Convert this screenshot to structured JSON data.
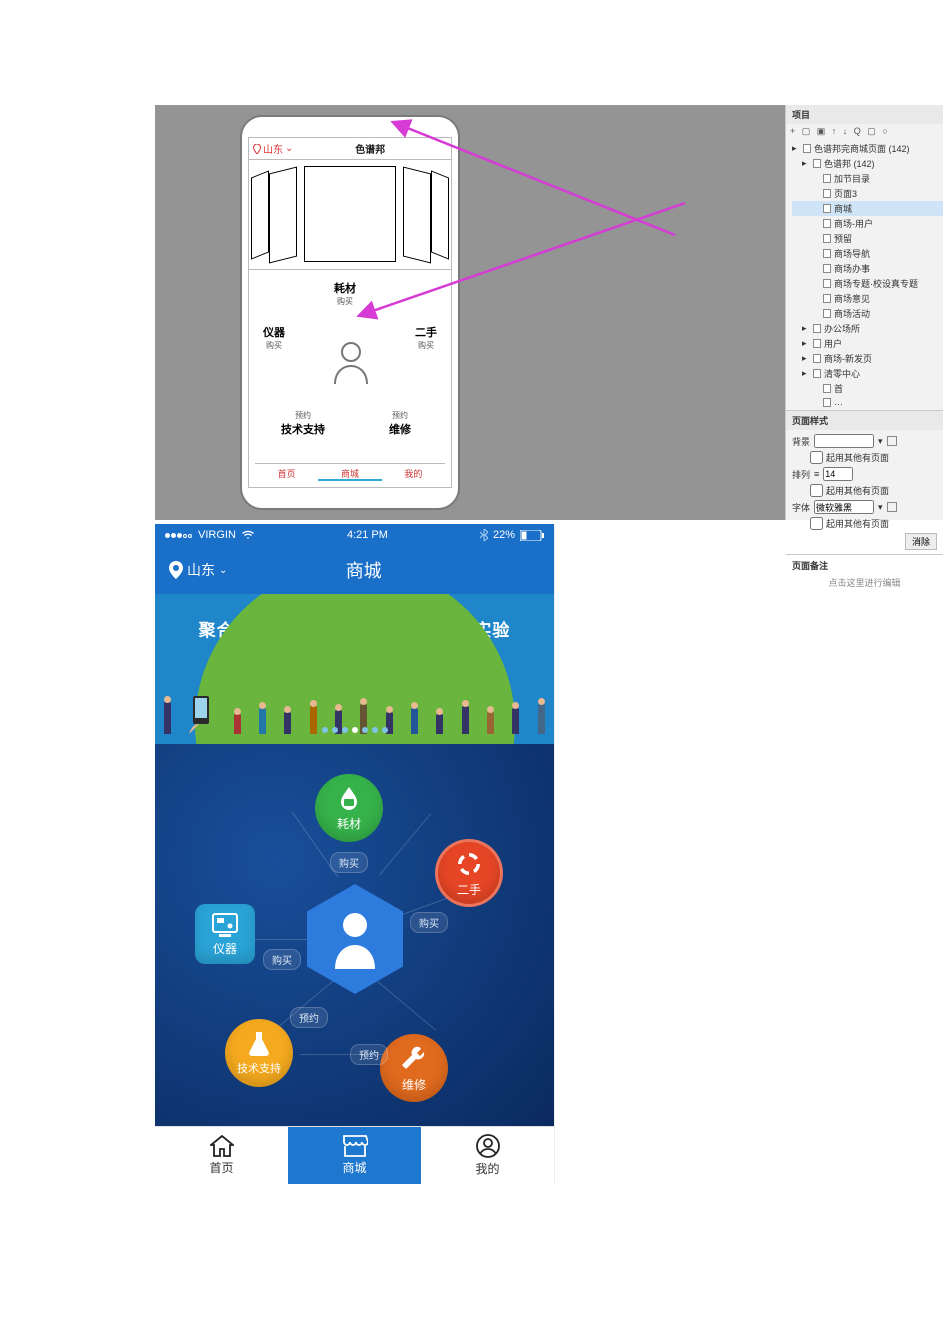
{
  "wireframe": {
    "location_label": "山东",
    "app_title": "色谱邦",
    "categories": {
      "top": {
        "label": "耗材",
        "sub": "购买"
      },
      "left": {
        "label": "仪器",
        "sub": "购买"
      },
      "right": {
        "label": "二手",
        "sub": "购买"
      },
      "bl": {
        "label": "技术支持",
        "sub": "预约"
      },
      "br": {
        "label": "维修",
        "sub": "预约"
      }
    },
    "tabs": [
      "首页",
      "商城",
      "我的"
    ]
  },
  "axure_panel": {
    "project_header": "项目",
    "toolbar_glyphs": "+ ▢ ▣ ↑ ↓ Q ▢ ○",
    "tree": [
      {
        "label": "色谱邦完商城页面 (142)",
        "indent": 0
      },
      {
        "label": "色谱邦 (142)",
        "indent": 1
      },
      {
        "label": "加节目录",
        "indent": 2
      },
      {
        "label": "页面3",
        "indent": 2
      },
      {
        "label": "商城",
        "indent": 2,
        "selected": true
      },
      {
        "label": "商场-用户",
        "indent": 2
      },
      {
        "label": "预留",
        "indent": 2
      },
      {
        "label": "商场导航",
        "indent": 2
      },
      {
        "label": "商场办事",
        "indent": 2
      },
      {
        "label": "商场专题·校设真专题",
        "indent": 2
      },
      {
        "label": "商场意见",
        "indent": 2
      },
      {
        "label": "商场活动",
        "indent": 2
      },
      {
        "label": "办公场所",
        "indent": 1
      },
      {
        "label": "用户",
        "indent": 1
      },
      {
        "label": "商场-新发页",
        "indent": 1
      },
      {
        "label": "清零中心",
        "indent": 1
      },
      {
        "label": "首",
        "indent": 2
      },
      {
        "label": "…",
        "indent": 2
      }
    ],
    "style_header": "页面样式",
    "style": {
      "bg_label": "背景",
      "bg_checkbox": "起用其他有页面",
      "align_label": "排列",
      "align_value": "14",
      "align_checkbox": "起用其他有页面",
      "font_label": "字体",
      "font_value": "微软雅黑",
      "font_checkbox": "起用其他有页面",
      "clear_button": "消除"
    },
    "notes_header": "页面备注",
    "notes_hint": "点击这里进行编辑"
  },
  "mockup": {
    "statusbar": {
      "carrier": "VIRGIN",
      "time": "4:21 PM",
      "battery_text": "22%"
    },
    "topnav": {
      "location": "山东",
      "title": "商城"
    },
    "banner_text": "聚合众人的智慧   让天下没有难做的实验",
    "pager_count": 7,
    "pager_active_index": 3,
    "nodes": {
      "haocai": {
        "label": "耗材",
        "color": "#36b24a"
      },
      "ershou": {
        "label": "二手",
        "color": "#e74626"
      },
      "yiqi": {
        "label": "仪器",
        "color": "#2aa3d6"
      },
      "jishu": {
        "label": "技术支持",
        "color": "#f4a91e"
      },
      "weixiu": {
        "label": "维修",
        "color": "#e06a1e"
      }
    },
    "chips": {
      "buy": "购买",
      "book": "预约"
    },
    "tabs": [
      {
        "label": "首页",
        "icon": "home"
      },
      {
        "label": "商城",
        "icon": "store",
        "active": true
      },
      {
        "label": "我的",
        "icon": "user"
      }
    ]
  }
}
